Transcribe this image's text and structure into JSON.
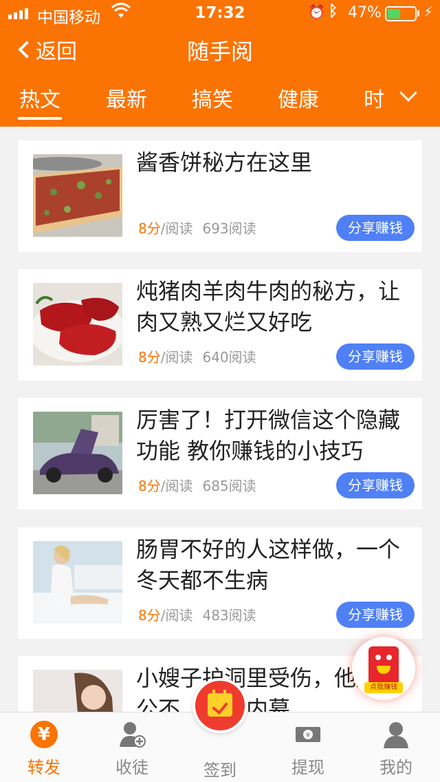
{
  "status_bar": {
    "carrier": "中国移动",
    "time": "17:32",
    "battery_percent": "47%",
    "battery_level": 0.47
  },
  "nav": {
    "back_label": "返回",
    "title": "随手阅"
  },
  "tabs": [
    {
      "label": "热文",
      "active": true
    },
    {
      "label": "最新",
      "active": false
    },
    {
      "label": "搞笑",
      "active": false
    },
    {
      "label": "健康",
      "active": false
    },
    {
      "label": "时",
      "active": false
    }
  ],
  "articles": [
    {
      "title": "酱香饼秘方在这里",
      "score": "8分",
      "per_read": "/阅读",
      "reads": "693阅读",
      "share_label": "分享赚钱",
      "thumb": "pizza-image"
    },
    {
      "title": "炖猪肉羊肉牛肉的秘方，让肉又熟又烂又好吃",
      "score": "8分",
      "per_read": "/阅读",
      "reads": "640阅读",
      "share_label": "分享赚钱",
      "thumb": "raw-beef-image"
    },
    {
      "title": "厉害了！打开微信这个隐藏功能 教你赚钱的小技巧",
      "score": "8分",
      "per_read": "/阅读",
      "reads": "685阅读",
      "share_label": "分享赚钱",
      "thumb": "sports-car-image"
    },
    {
      "title": "肠胃不好的人这样做，一个冬天都不生病",
      "score": "8分",
      "per_read": "/阅读",
      "reads": "483阅读",
      "share_label": "分享赚钱",
      "thumb": "woman-on-bed-image"
    },
    {
      "title": "小嫂子护洞里受伤，他趁老公不…什么内幕",
      "score": "",
      "per_read": "",
      "reads": "",
      "share_label": "",
      "thumb": "woman-portrait-image"
    }
  ],
  "float_button": {
    "label": "点我赚钱"
  },
  "tabbar": [
    {
      "label": "转发",
      "active": true,
      "icon": "yen-icon"
    },
    {
      "label": "收徒",
      "active": false,
      "icon": "add-user-icon"
    },
    {
      "label": "签到",
      "active": false,
      "icon": "calendar-check-icon"
    },
    {
      "label": "提现",
      "active": false,
      "icon": "money-icon"
    },
    {
      "label": "我的",
      "active": false,
      "icon": "profile-icon"
    }
  ],
  "colors": {
    "brand": "#fb7303",
    "share_button": "#4f80f5",
    "checkin": "#ef3b2e"
  }
}
